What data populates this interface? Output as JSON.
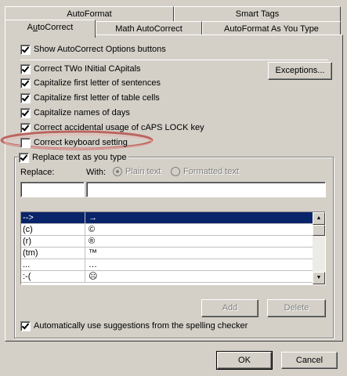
{
  "tabs": {
    "row_back": [
      "AutoFormat",
      "Smart Tags"
    ],
    "row_front": [
      "AutoCorrect",
      "Math AutoCorrect",
      "AutoFormat As You Type"
    ],
    "active": "AutoCorrect"
  },
  "options": {
    "show_buttons": {
      "label": "Show AutoCorrect Options buttons",
      "checked": true
    },
    "two_initial_caps": {
      "label": "Correct TWo INitial CApitals",
      "checked": true
    },
    "cap_sentences": {
      "label": "Capitalize first letter of sentences",
      "checked": true
    },
    "cap_table_cells": {
      "label": "Capitalize first letter of table cells",
      "checked": true
    },
    "cap_days": {
      "label": "Capitalize names of days",
      "checked": true
    },
    "caps_lock": {
      "label": "Correct accidental usage of cAPS LOCK key",
      "checked": true
    },
    "keyboard_setting": {
      "label": "Correct keyboard setting",
      "checked": false
    },
    "replace_text": {
      "label": "Replace text as you type",
      "checked": true
    },
    "spelling_suggestions": {
      "label": "Automatically use suggestions from the spelling checker",
      "checked": true
    }
  },
  "exceptions_label": "Exceptions...",
  "replace_section": {
    "replace_label": "Replace:",
    "with_label": "With:",
    "plain_text": "Plain text",
    "formatted_text": "Formatted text",
    "replace_value": "",
    "with_value": ""
  },
  "entries": [
    {
      "replace": "-->",
      "with": "→",
      "selected": true
    },
    {
      "replace": "(c)",
      "with": "©",
      "selected": false
    },
    {
      "replace": "(r)",
      "with": "®",
      "selected": false
    },
    {
      "replace": "(tm)",
      "with": "™",
      "selected": false
    },
    {
      "replace": "...",
      "with": "…",
      "selected": false
    },
    {
      "replace": ":-(",
      "with": "☹",
      "selected": false
    }
  ],
  "buttons": {
    "add": "Add",
    "delete": "Delete",
    "ok": "OK",
    "cancel": "Cancel"
  },
  "highlight_color": "#c0403c"
}
